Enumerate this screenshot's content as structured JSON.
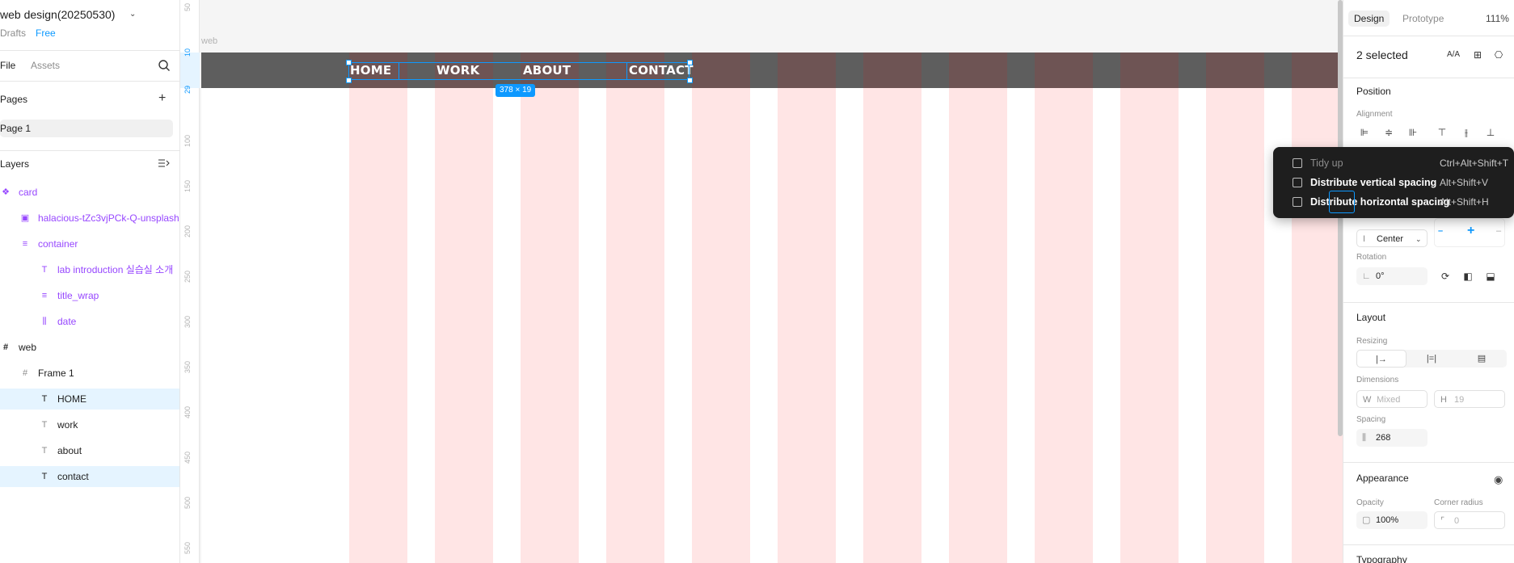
{
  "project": {
    "title": "web design(20250530)",
    "drafts": "Drafts",
    "plan": "Free"
  },
  "left_tabs": {
    "file": "File",
    "assets": "Assets"
  },
  "pages": {
    "title": "Pages",
    "items": [
      "Page 1"
    ]
  },
  "layers": {
    "title": "Layers",
    "items": [
      {
        "label": "card",
        "icon": "component-icon"
      },
      {
        "label": "halacious-tZc3vjPCk-Q-unsplash",
        "icon": "image-icon"
      },
      {
        "label": "container",
        "icon": "auto-layout-icon"
      },
      {
        "label": "lab introduction 실습실 소개",
        "icon": "text-icon"
      },
      {
        "label": "title_wrap",
        "icon": "auto-layout-icon"
      },
      {
        "label": "date",
        "icon": "auto-layout-icon"
      },
      {
        "label": "web",
        "icon": "frame-icon"
      },
      {
        "label": "Frame 1",
        "icon": "frame-icon"
      },
      {
        "label": "HOME",
        "icon": "text-icon"
      },
      {
        "label": "work",
        "icon": "text-icon"
      },
      {
        "label": "about",
        "icon": "text-icon"
      },
      {
        "label": "contact",
        "icon": "text-icon"
      }
    ]
  },
  "canvas": {
    "frame_label": "web",
    "nav": [
      "HOME",
      "WORK",
      "ABOUT",
      "CONTACT"
    ],
    "selection_size": "378 × 19",
    "ruler_ticks": [
      "50",
      "10",
      "29",
      "100",
      "150",
      "200",
      "250",
      "300",
      "350",
      "400",
      "450",
      "500",
      "550"
    ]
  },
  "right_panel": {
    "tabs": {
      "design": "Design",
      "prototype": "Prototype"
    },
    "zoom": "111%",
    "selection": "2 selected",
    "position": "Position",
    "alignment": "Alignment",
    "align_center": "Center",
    "rotation_label": "Rotation",
    "rotation": "0°",
    "layout": "Layout",
    "resizing": "Resizing",
    "dimensions": "Dimensions",
    "w_label": "W",
    "w_value": "Mixed",
    "h_label": "H",
    "h_value": "19",
    "spacing_label": "Spacing",
    "spacing": "268",
    "appearance": "Appearance",
    "opacity_label": "Opacity",
    "opacity": "100%",
    "radius_label": "Corner radius",
    "radius": "0",
    "typography": "Typography"
  },
  "menu": [
    {
      "label": "Tidy up",
      "shortcut": "Ctrl+Alt+Shift+T",
      "disabled": true
    },
    {
      "label": "Distribute vertical spacing",
      "shortcut": "Alt+Shift+V",
      "disabled": false
    },
    {
      "label": "Distribute horizontal spacing",
      "shortcut": "Alt+Shift+H",
      "disabled": false
    }
  ],
  "colors": {
    "accent": "#0d99ff",
    "component": "#9747ff",
    "nav_bg": "#5e5e5e",
    "column": "#ffe5e5",
    "menu_bg": "#1e1e1e"
  }
}
